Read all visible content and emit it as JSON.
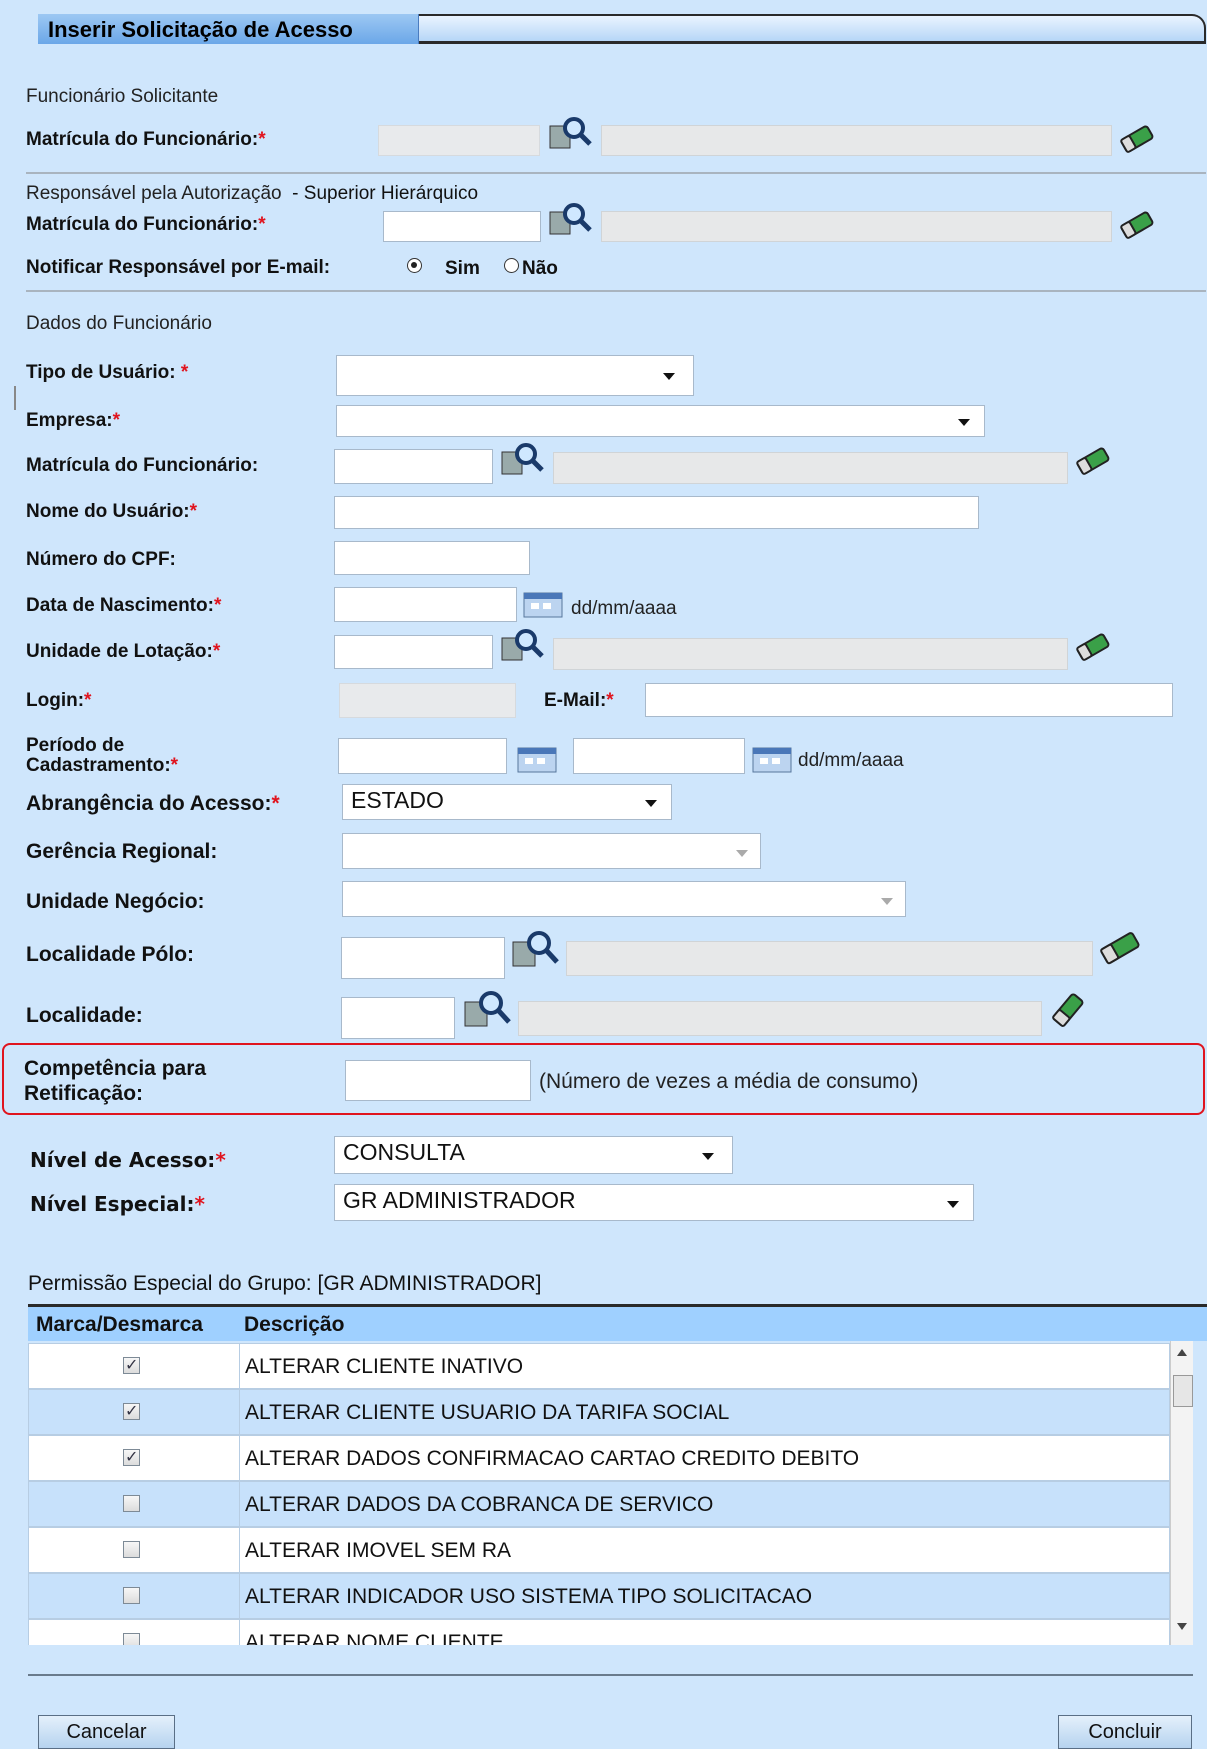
{
  "header": {
    "title": "Inserir Solicitação de Acesso"
  },
  "solicitante": {
    "section_title": "Funcionário Solicitante",
    "matricula_label": "Matrícula do Funcionário:",
    "required": "*"
  },
  "responsavel": {
    "section_title": "Responsável pela Autorização",
    "section_subtitle": "- Superior Hierárquico",
    "matricula_label": "Matrícula do Funcionário:",
    "required": "*",
    "notify_label": "Notificar Responsável por E-mail:",
    "opt_sim": "Sim",
    "opt_nao": "Não",
    "selected": "Sim"
  },
  "dados": {
    "section_title": "Dados do Funcionário",
    "tipo_usuario_label": "Tipo de Usuário:",
    "empresa_label": "Empresa:",
    "matricula_label": "Matrícula do Funcionário:",
    "nome_label": "Nome do Usuário:",
    "cpf_label": "Número do CPF:",
    "nascimento_label": "Data de Nascimento:",
    "date_hint": "dd/mm/aaaa",
    "unidade_lotacao_label": "Unidade de Lotação:",
    "login_label": "Login:",
    "email_label": "E-Mail:",
    "periodo_label_1": "Período de",
    "periodo_label_2": "Cadastramento:",
    "abrangencia_label": "Abrangência do Acesso:",
    "abrangencia_value": "ESTADO",
    "gerencia_label": "Gerência Regional:",
    "unidade_negocio_label": "Unidade Negócio:",
    "localidade_polo_label": "Localidade Pólo:",
    "localidade_label": "Localidade:",
    "competencia_label_1": "Competência para",
    "competencia_label_2": "Retificação:",
    "competencia_hint": "(Número de vezes a média de consumo)",
    "nivel_acesso_label": "Nível de Acesso:",
    "nivel_acesso_value": "CONSULTA",
    "nivel_especial_label": "Nível Especial:",
    "nivel_especial_value": "GR ADMINISTRADOR",
    "required": "*"
  },
  "permissoes": {
    "title": "Permissão Especial do Grupo:",
    "group": "[GR ADMINISTRADOR]",
    "col_marca": "Marca/Desmarca",
    "col_desc": "Descrição",
    "rows": [
      {
        "label": "ALTERAR CLIENTE INATIVO",
        "checked": true
      },
      {
        "label": "ALTERAR CLIENTE USUARIO DA TARIFA SOCIAL",
        "checked": true
      },
      {
        "label": "ALTERAR DADOS CONFIRMACAO CARTAO CREDITO DEBITO",
        "checked": true
      },
      {
        "label": "ALTERAR DADOS DA COBRANCA DE SERVICO",
        "checked": false
      },
      {
        "label": "ALTERAR IMOVEL SEM RA",
        "checked": false
      },
      {
        "label": "ALTERAR INDICADOR USO SISTEMA TIPO SOLICITACAO",
        "checked": false
      },
      {
        "label": "ALTERAR NOME CLIENTE",
        "checked": false
      }
    ]
  },
  "footer": {
    "cancel_label": "Cancelar",
    "submit_label": "Concluir"
  },
  "colors": {
    "background": "#cfe6fc",
    "required": "#e0141e",
    "highlight_box": "#e0141e",
    "grid_header": "#9fd0ff"
  },
  "icons": [
    "search-icon",
    "eraser-icon",
    "calendar-icon",
    "chevron-down-icon"
  ]
}
